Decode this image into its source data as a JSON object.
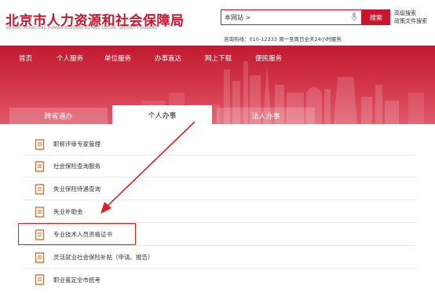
{
  "header": {
    "title": "北京市人力资源和社会保障局",
    "subtitle": "BEIJING MUNICIPAL HUMAN RESOURCES AND SOCIAL SECURITY BUREAU",
    "search_scope": "本网站 >",
    "search_button": "搜索",
    "advanced_search": "高级搜索",
    "policy_search": "政策文件搜索",
    "hotline": "咨询热线：010-12333 周一至周日全天24小时服务"
  },
  "nav": {
    "items": [
      "首页",
      "个人服务",
      "单位服务",
      "办事直达",
      "网上下载",
      "便民服务"
    ]
  },
  "tabs": {
    "items": [
      "跨省通办",
      "个人办事",
      "法人办事"
    ],
    "active_index": 1
  },
  "list": {
    "items": [
      "职称评审专家管理",
      "社会保险查询服务",
      "失业保险待遇查询",
      "失业补助金",
      "专业技术人员资格证书",
      "灵活就业社会保险补贴（申请、报告）",
      "职业鉴定全市统考"
    ],
    "highlighted_index": 4
  },
  "colors": {
    "brand_red": "#c8162c",
    "annotation_red": "#e02020"
  }
}
